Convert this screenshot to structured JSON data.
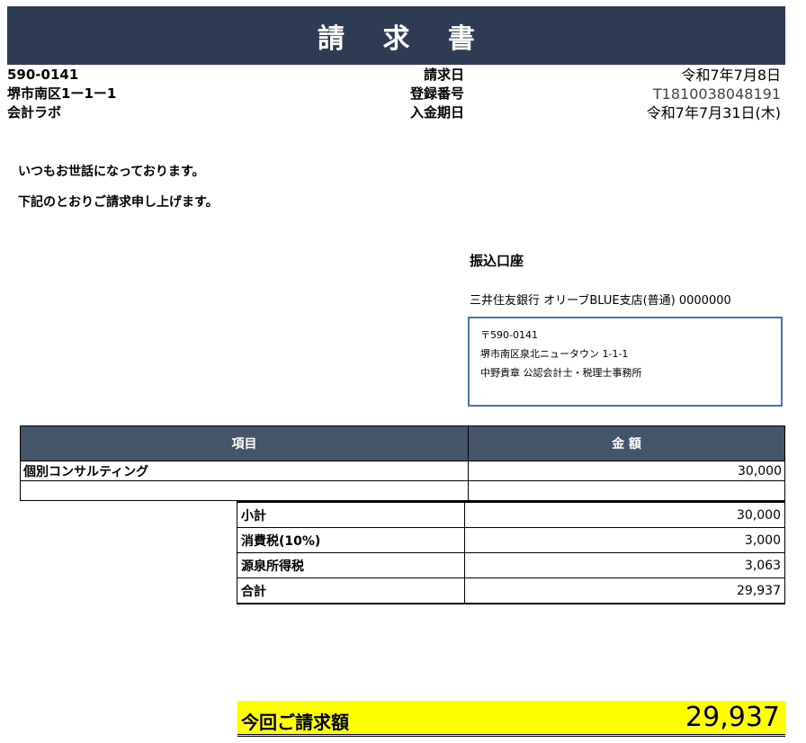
{
  "title": "請 求 書",
  "recipient": {
    "postal": "590-0141",
    "address": "堺市南区1ー1ー1",
    "name": "会計ラボ"
  },
  "meta": {
    "labels": [
      "請求日",
      "登録番号",
      "入金期日"
    ],
    "values": [
      "令和7年7月8日",
      "T1810038048191",
      "令和7年7月31日(木)"
    ]
  },
  "greeting": [
    "いつもお世話になっております。",
    "下記のとおりご請求申し上げます。"
  ],
  "bank": {
    "title": "振込口座",
    "account": "三井住友銀行 オリーブBLUE支店(普通) 0000000"
  },
  "sender": {
    "postal": "〒590-0141",
    "address": "堺市南区泉北ニュータウン 1-1-1",
    "name": "中野貴章 公認会計士・税理士事務所"
  },
  "items_table": {
    "headers": [
      "項目",
      "金 額"
    ],
    "rows": [
      {
        "item": "個別コンサルティング",
        "amount": "30,000"
      },
      {
        "item": "",
        "amount": ""
      }
    ]
  },
  "summary": [
    {
      "label": "小計",
      "amount": "30,000"
    },
    {
      "label": "消費税(10%)",
      "amount": "3,000"
    },
    {
      "label": "源泉所得税",
      "amount": "3,063"
    },
    {
      "label": "合計",
      "amount": "29,937"
    }
  ],
  "total": {
    "label": "今回ご請求額",
    "value": "29,937"
  },
  "colors": {
    "title_bar": "#2d3b55",
    "table_header": "#44546a",
    "total_bg": "#ffff00",
    "box_border": "#4a72c0"
  }
}
